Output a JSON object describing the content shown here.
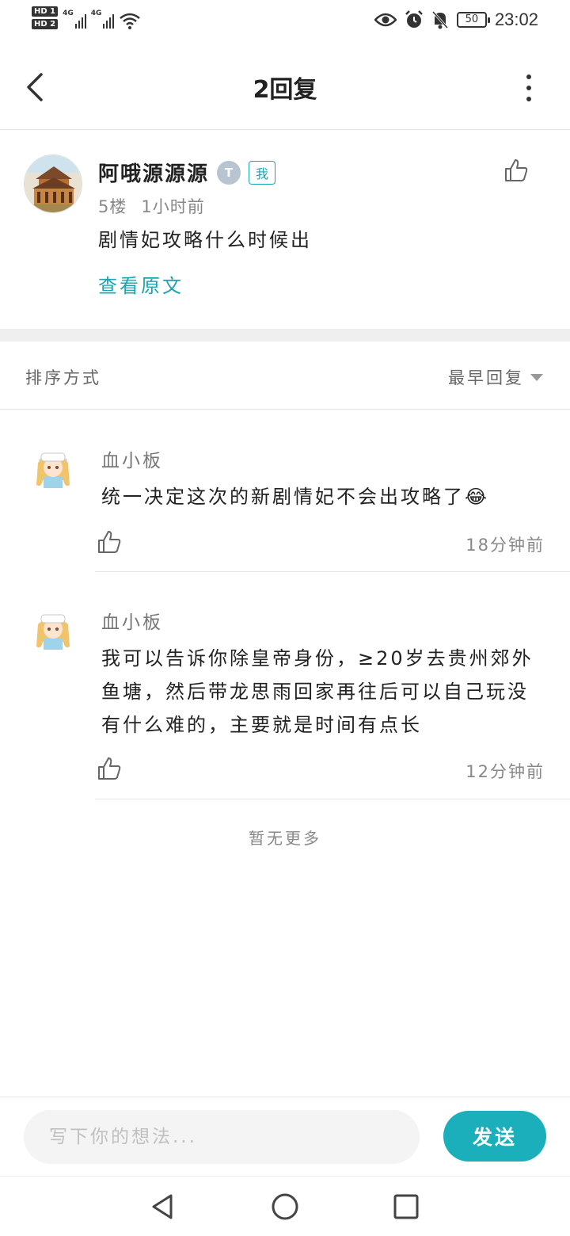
{
  "status_bar": {
    "hd1": "HD 1",
    "hd2": "HD 2",
    "net1": "4G",
    "net2": "4G",
    "battery": "50",
    "time": "23:02"
  },
  "nav": {
    "title": "2回复"
  },
  "post": {
    "author": "阿哦源源源",
    "level": "T",
    "me_badge": "我",
    "floor": "5楼",
    "time": "1小时前",
    "content": "剧情妃攻略什么时候出",
    "view_original": "查看原文"
  },
  "sort": {
    "label": "排序方式",
    "value": "最早回复"
  },
  "replies": [
    {
      "author": "血小板",
      "text": "统一决定这次的新剧情妃不会出攻略了😂",
      "time": "18分钟前"
    },
    {
      "author": "血小板",
      "text": "我可以告诉你除皇帝身份，≥20岁去贵州郊外鱼塘，然后带龙思雨回家再往后可以自己玩没有什么难的，主要就是时间有点长",
      "time": "12分钟前"
    }
  ],
  "no_more": "暂无更多",
  "input": {
    "placeholder": "写下你的想法...",
    "send_label": "发送"
  },
  "colors": {
    "accent": "#1aafbb",
    "link": "#1aa5b2"
  }
}
